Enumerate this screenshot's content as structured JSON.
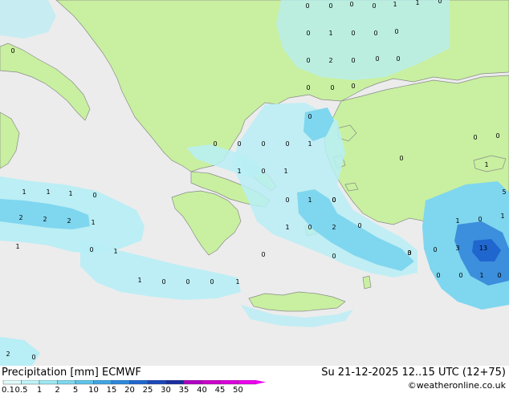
{
  "map": {
    "precip_labels": [
      "0",
      "0",
      "0",
      "0",
      "1",
      "1",
      "0",
      "0",
      "1",
      "0",
      "0",
      "0",
      "0",
      "2",
      "0",
      "0",
      "0",
      "0",
      "0",
      "0",
      "0",
      "0",
      "0",
      "0",
      "0",
      "0",
      "1",
      "1",
      "0",
      "1",
      "0",
      "1",
      "0",
      "1",
      "1",
      "1",
      "0",
      "2",
      "2",
      "2",
      "1",
      "1",
      "0",
      "1",
      "1",
      "0",
      "0",
      "0",
      "1",
      "0",
      "1",
      "0",
      "2",
      "0",
      "0",
      "1",
      "0",
      "0",
      "3",
      "0",
      "3",
      "13",
      "1",
      "5",
      "0",
      "0",
      "1",
      "0",
      "0",
      "0",
      "1",
      "0",
      "0",
      "2",
      "0"
    ]
  },
  "footer": {
    "title": "Precipitation [mm]  ECMWF",
    "datetime": "Su 21-12-2025 12..15 UTC (12+75)",
    "credit": "©weatheronline.co.uk"
  },
  "legend": {
    "labels": [
      "0.1",
      "0.5",
      "1",
      "2",
      "5",
      "10",
      "15",
      "20",
      "25",
      "30",
      "35",
      "40",
      "45",
      "50"
    ],
    "colors": [
      "#e0fafa",
      "#bff3f7",
      "#9fe8f2",
      "#7ed7ee",
      "#5fc3ea",
      "#3fa6e3",
      "#2b88dc",
      "#1f66cf",
      "#1b47b9",
      "#1a2d9f",
      "#b000c4",
      "#cc00cc",
      "#dd00dd",
      "#ee00ee"
    ]
  },
  "colors": {
    "land": "#c8f0a0",
    "sea": "#ececec",
    "light_precip": "#b8eef6",
    "moderate_precip": "#7fd6ef",
    "heavy_precip": "#3b8fdc"
  }
}
